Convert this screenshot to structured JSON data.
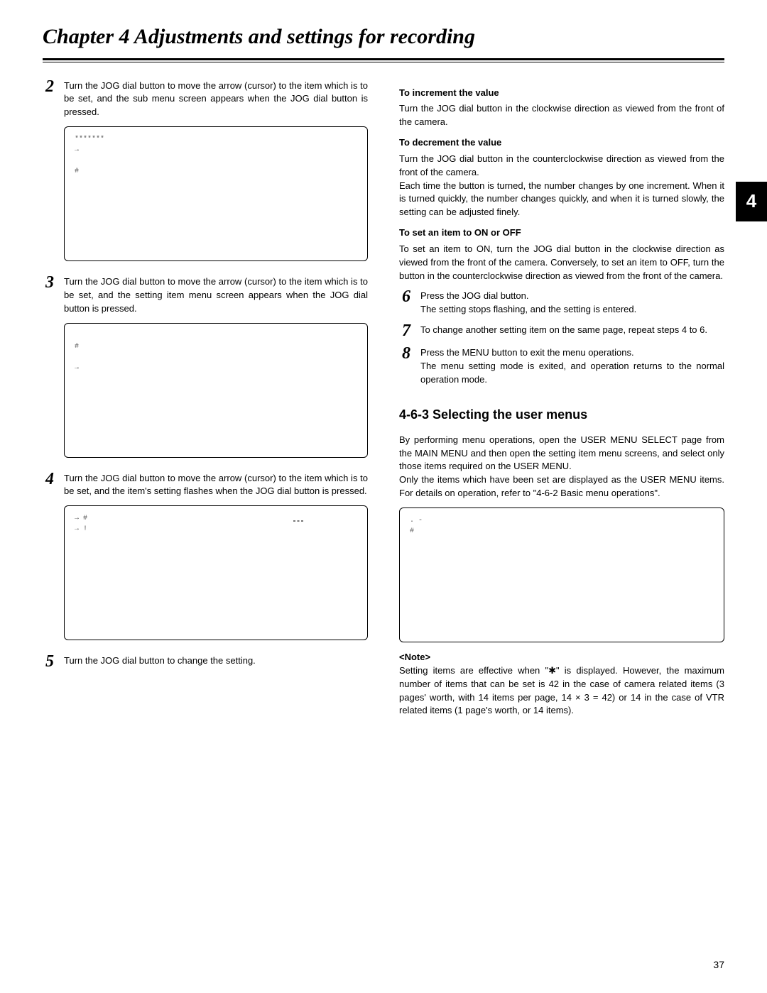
{
  "chapter_title": "Chapter 4  Adjustments and settings for recording",
  "tab": "4",
  "page_number": "37",
  "left": {
    "step2_num": "2",
    "step2_text": "Turn the JOG dial button to move the arrow (cursor) to the item which is to be set, and the sub menu screen appears when the JOG dial button is pressed.",
    "screen2_l1": "*******",
    "screen2_l2": "→",
    "screen2_l3": " ",
    "screen2_l4": "#",
    "step3_num": "3",
    "step3_text": "Turn the JOG dial button to move the arrow (cursor) to the item which is to be set, and the setting item menu screen appears when the JOG dial button is pressed.",
    "screen3_l1": " ",
    "screen3_l2": "#",
    "screen3_l3": " ",
    "screen3_l4": "→",
    "step4_num": "4",
    "step4_text": "Turn the JOG dial button to move the arrow (cursor) to the item which is to be set, and the item's setting flashes when the JOG dial button is pressed.",
    "screen4_l1": "→ #",
    "screen4_l2": "→ !",
    "screen4_box": " ",
    "step5_num": "5",
    "step5_text": "Turn the JOG dial button to change the setting."
  },
  "right": {
    "inc_head": "To increment the value",
    "inc_text": "Turn the JOG dial button in the clockwise direction as viewed from the front of the camera.",
    "dec_head": "To decrement the value",
    "dec_text": "Turn the JOG dial button in the counterclockwise direction as viewed from the front of the camera.",
    "dec_text2": "Each time the button is turned, the number changes by one increment.  When it is turned quickly, the number changes quickly, and when it is turned slowly, the setting can be adjusted finely.",
    "onoff_head": "To set an item to ON or OFF",
    "onoff_text": "To set an item to ON, turn the JOG dial button in the clockwise direction as viewed from the front of the camera.  Conversely, to set an item to OFF, turn the button in the counterclockwise direction as viewed from the front of the camera.",
    "step6_num": "6",
    "step6_text": "Press the JOG dial button.\nThe setting stops flashing, and the setting is entered.",
    "step7_num": "7",
    "step7_text": "To change another setting item on the same page, repeat steps 4 to 6.",
    "step8_num": "8",
    "step8_text": "Press the MENU button to exit the menu operations.\nThe menu setting mode is exited, and operation returns to the normal operation mode.",
    "section_head": "4-6-3 Selecting the user menus",
    "section_p1": "By performing menu operations, open the USER MENU SELECT page from the MAIN MENU and then open the setting item menu screens, and select only those items required on the USER MENU.",
    "section_p2": "Only the items which have been set are displayed as the USER MENU items.  For details on operation, refer to \"4-6-2 Basic menu operations\".",
    "screenR_l1": "                         .   -",
    "screenR_l2": "#",
    "note_label": "<Note>",
    "note_text": "Setting items are effective when \"✱\" is displayed. However, the maximum number of items that can be set is 42 in the case of camera related items (3 pages' worth, with 14 items per page, 14 × 3 = 42) or 14 in the case of VTR related items (1 page's worth, or 14 items)."
  }
}
